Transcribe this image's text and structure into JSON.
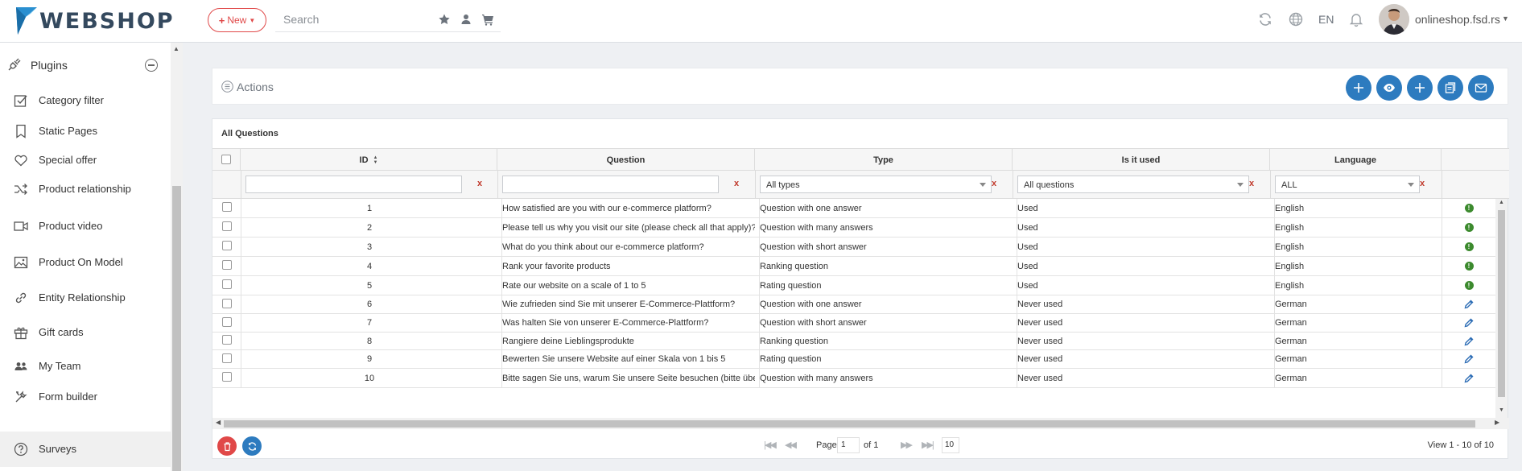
{
  "app": {
    "name": "WEBSHOP"
  },
  "header": {
    "new_label": "New",
    "search_placeholder": "Search",
    "language": "EN",
    "user_name": "onlineshop.fsd.rs"
  },
  "sidebar": {
    "section_label": "Plugins",
    "items": [
      {
        "label": "Category filter",
        "icon": "checkbox-edit-icon"
      },
      {
        "label": "Static Pages",
        "icon": "bookmark-icon"
      },
      {
        "label": "Special offer",
        "icon": "heart-icon"
      },
      {
        "label": "Product relationship",
        "icon": "shuffle-icon"
      },
      {
        "label": "Product video",
        "icon": "video-icon"
      },
      {
        "label": "Product On Model",
        "icon": "image-icon"
      },
      {
        "label": "Entity Relationship",
        "icon": "link-icon"
      },
      {
        "label": "Gift cards",
        "icon": "gift-icon"
      },
      {
        "label": "My Team",
        "icon": "team-icon"
      },
      {
        "label": "Form builder",
        "icon": "tools-icon"
      },
      {
        "label": "Surveys",
        "icon": "question-circle-icon"
      }
    ]
  },
  "actions": {
    "label": "Actions"
  },
  "grid": {
    "title": "All Questions",
    "columns": {
      "id": "ID",
      "question": "Question",
      "type": "Type",
      "used": "Is it used",
      "language": "Language"
    },
    "filters": {
      "clear": "x",
      "type": "All types",
      "used": "All questions",
      "language": "ALL"
    },
    "rows": [
      {
        "id": "1",
        "question": "How satisfied are you with our e-commerce platform?",
        "type": "Question with one answer",
        "used": "Used",
        "language": "English",
        "status": "info"
      },
      {
        "id": "2",
        "question": "Please tell us why you visit our site (please check all that apply)?",
        "type": "Question with many answers",
        "used": "Used",
        "language": "English",
        "status": "info"
      },
      {
        "id": "3",
        "question": "What do you think about our e-commerce platform?",
        "type": "Question with short answer",
        "used": "Used",
        "language": "English",
        "status": "info"
      },
      {
        "id": "4",
        "question": "Rank your favorite products",
        "type": "Ranking question",
        "used": "Used",
        "language": "English",
        "status": "info"
      },
      {
        "id": "5",
        "question": "Rate our website on a scale of 1 to 5",
        "type": "Rating question",
        "used": "Used",
        "language": "English",
        "status": "info"
      },
      {
        "id": "6",
        "question": "Wie zufrieden sind Sie mit unserer E-Commerce-Plattform?",
        "type": "Question with one answer",
        "used": "Never used",
        "language": "German",
        "status": "edit"
      },
      {
        "id": "7",
        "question": "Was halten Sie von unserer E-Commerce-Plattform?",
        "type": "Question with short answer",
        "used": "Never used",
        "language": "German",
        "status": "edit"
      },
      {
        "id": "8",
        "question": "Rangiere deine Lieblingsprodukte",
        "type": "Ranking question",
        "used": "Never used",
        "language": "German",
        "status": "edit"
      },
      {
        "id": "9",
        "question": "Bewerten Sie unsere Website auf einer Skala von 1 bis 5",
        "type": "Rating question",
        "used": "Never used",
        "language": "German",
        "status": "edit"
      },
      {
        "id": "10",
        "question": "Bitte sagen Sie uns, warum Sie unsere Seite besuchen (bitte überprüfen Sie alle zutreffenden)?",
        "type": "Question with many answers",
        "used": "Never used",
        "language": "German",
        "status": "edit"
      }
    ]
  },
  "pager": {
    "page_label": "Page",
    "page_value": "1",
    "of_label": "of 1",
    "page_size": "10",
    "view_text": "View 1 - 10 of 10"
  },
  "colors": {
    "accent": "#2d7bbf",
    "danger": "#e04848",
    "used": "#3c8a2e",
    "edit": "#2d6db5"
  }
}
